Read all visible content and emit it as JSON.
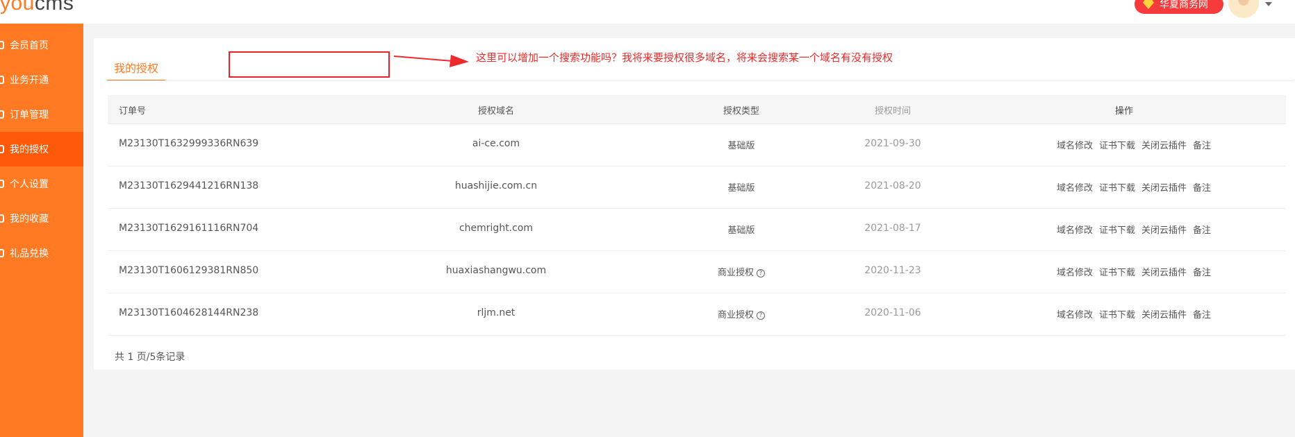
{
  "header": {
    "logo_part1": "you",
    "logo_part2": "cms",
    "brand_pill_label": "华夏商务网"
  },
  "sidebar": {
    "items": [
      {
        "label": "会员首页"
      },
      {
        "label": "业务开通"
      },
      {
        "label": "订单管理"
      },
      {
        "label": "我的授权"
      },
      {
        "label": "个人设置"
      },
      {
        "label": "我的收藏"
      },
      {
        "label": "礼品兑换"
      }
    ],
    "active_index": 3
  },
  "main": {
    "tab_label": "我的授权",
    "annotation_note": "这里可以增加一个搜索功能吗？我将来要授权很多域名，将来会搜索某一个域名有没有授权",
    "table": {
      "headers": [
        "订单号",
        "授权域名",
        "授权类型",
        "授权时间",
        "操作"
      ],
      "operations": [
        "域名修改",
        "证书下载",
        "关闭云插件",
        "备注"
      ],
      "rows": [
        {
          "order": "M23130T1632999336RN639",
          "domain": "ai-ce.com",
          "type": "基础版",
          "has_help": false,
          "time": "2021-09-30"
        },
        {
          "order": "M23130T1629441216RN138",
          "domain": "huashijie.com.cn",
          "type": "基础版",
          "has_help": false,
          "time": "2021-08-20"
        },
        {
          "order": "M23130T1629161116RN704",
          "domain": "chemright.com",
          "type": "基础版",
          "has_help": false,
          "time": "2021-08-17"
        },
        {
          "order": "M23130T1606129381RN850",
          "domain": "huaxiashangwu.com",
          "type": "商业授权",
          "has_help": true,
          "time": "2020-11-23"
        },
        {
          "order": "M23130T1604628144RN238",
          "domain": "rljm.net",
          "type": "商业授权",
          "has_help": true,
          "time": "2020-11-06"
        }
      ]
    },
    "pager_text": "共 1 页/5条记录"
  },
  "colors": {
    "accent": "#ff7a22",
    "accent_active": "#ff5a0a",
    "annotation": "#ee2a2a"
  }
}
